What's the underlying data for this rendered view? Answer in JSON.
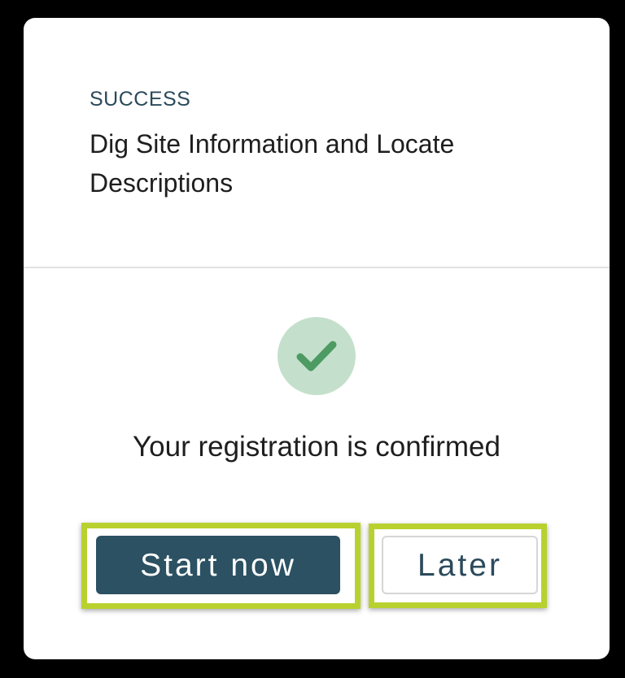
{
  "header": {
    "status_label": "SUCCESS",
    "course_title": "Dig Site Information and Locate Descriptions"
  },
  "confirmation": {
    "icon": "checkmark-icon",
    "message": "Your registration is confirmed"
  },
  "actions": {
    "start_label": "Start now",
    "later_label": "Later"
  },
  "colors": {
    "primary_button": "#2b5162",
    "success_circle": "#c4e0cc",
    "success_check": "#4e9a63",
    "highlight": "#b9d12f"
  }
}
